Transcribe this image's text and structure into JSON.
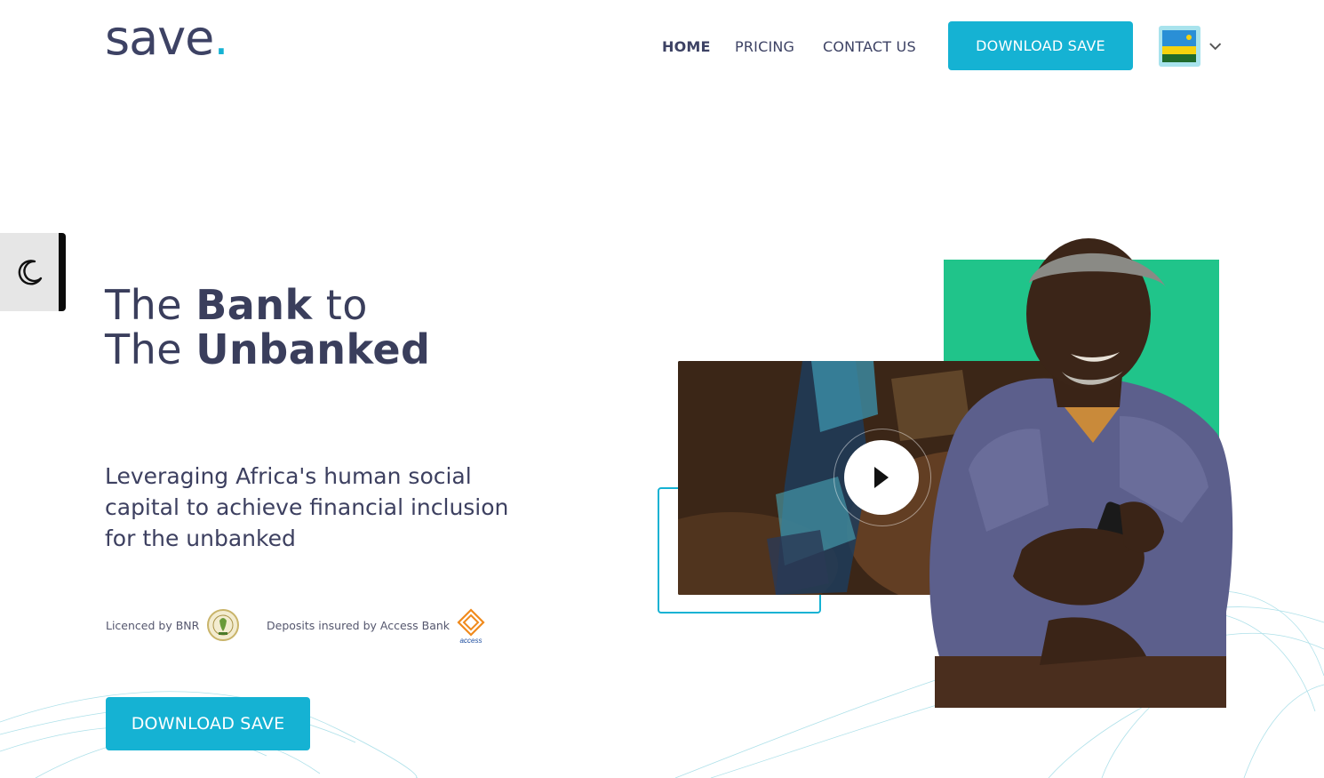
{
  "header": {
    "logo_text": "save",
    "logo_dot": ".",
    "nav": [
      {
        "label": "HOME",
        "active": true
      },
      {
        "label": "PRICING",
        "active": false
      },
      {
        "label": "CONTACT US",
        "active": false
      }
    ],
    "download_label": "DOWNLOAD SAVE",
    "language_icon": "rwanda-flag-icon",
    "language_chevron_icon": "chevron-down-icon"
  },
  "theme_toggle": {
    "icon": "moon-icon"
  },
  "hero": {
    "title_line1_pre": "The ",
    "title_line1_bold": "Bank",
    "title_line1_post": " to",
    "title_line2_pre": "The ",
    "title_line2_bold": "Unbanked",
    "subtitle": "Leveraging Africa's human social capital to achieve financial inclusion for the unbanked",
    "licence_text": "Licenced by BNR",
    "insurance_text": "Deposits insured by Access Bank",
    "access_logo_text": "access",
    "download_label": "DOWNLOAD SAVE",
    "video_play_icon": "play-icon"
  },
  "colors": {
    "accent": "#15b2d3",
    "green": "#20c48a",
    "text_dark": "#3a3e5c"
  }
}
